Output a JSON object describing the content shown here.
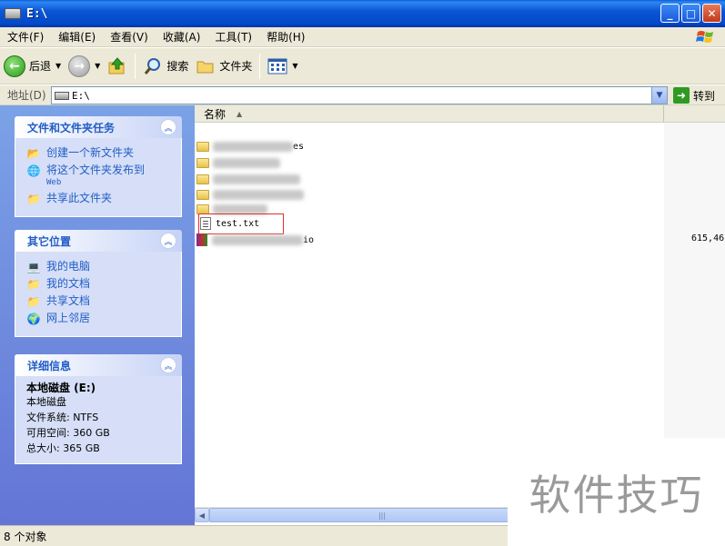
{
  "window": {
    "title": "E:\\",
    "controls": [
      "_",
      "□",
      "✕"
    ]
  },
  "menu": [
    {
      "label": "文件(F)"
    },
    {
      "label": "编辑(E)"
    },
    {
      "label": "查看(V)"
    },
    {
      "label": "收藏(A)"
    },
    {
      "label": "工具(T)"
    },
    {
      "label": "帮助(H)"
    }
  ],
  "toolbar": {
    "back": "后退",
    "search": "搜索",
    "folders": "文件夹"
  },
  "address": {
    "label": "地址(D)",
    "value": "E:\\",
    "go": "转到"
  },
  "tasks": {
    "title": "文件和文件夹任务",
    "items": [
      {
        "label": "创建一个新文件夹",
        "icon": "new-folder-icon"
      },
      {
        "label": "将这个文件夹发布到",
        "sub": "Web",
        "icon": "publish-web-icon"
      },
      {
        "label": "共享此文件夹",
        "icon": "share-folder-icon"
      }
    ]
  },
  "places": {
    "title": "其它位置",
    "items": [
      {
        "label": "我的电脑",
        "icon": "my-computer-icon"
      },
      {
        "label": "我的文档",
        "icon": "my-documents-icon"
      },
      {
        "label": "共享文档",
        "icon": "shared-documents-icon"
      },
      {
        "label": "网上邻居",
        "icon": "network-places-icon"
      }
    ]
  },
  "details": {
    "title": "详细信息",
    "name": "本地磁盘 (E:)",
    "type": "本地磁盘",
    "fs": "文件系统: NTFS",
    "free": "可用空间: 360 GB",
    "total": "总大小: 365 GB"
  },
  "list": {
    "header_name": "名称",
    "rows": [
      {
        "kind": "folder",
        "suffix": "es"
      },
      {
        "kind": "folder",
        "suffix": ""
      },
      {
        "kind": "folder",
        "suffix": ""
      },
      {
        "kind": "folder",
        "suffix": ""
      },
      {
        "kind": "folder",
        "suffix": ""
      },
      {
        "kind": "file",
        "name": "test.txt",
        "highlighted": true
      },
      {
        "kind": "archive",
        "suffix": "io",
        "size": "615,46"
      }
    ]
  },
  "status": {
    "text": "8 个对象"
  },
  "watermark": "软件技巧"
}
